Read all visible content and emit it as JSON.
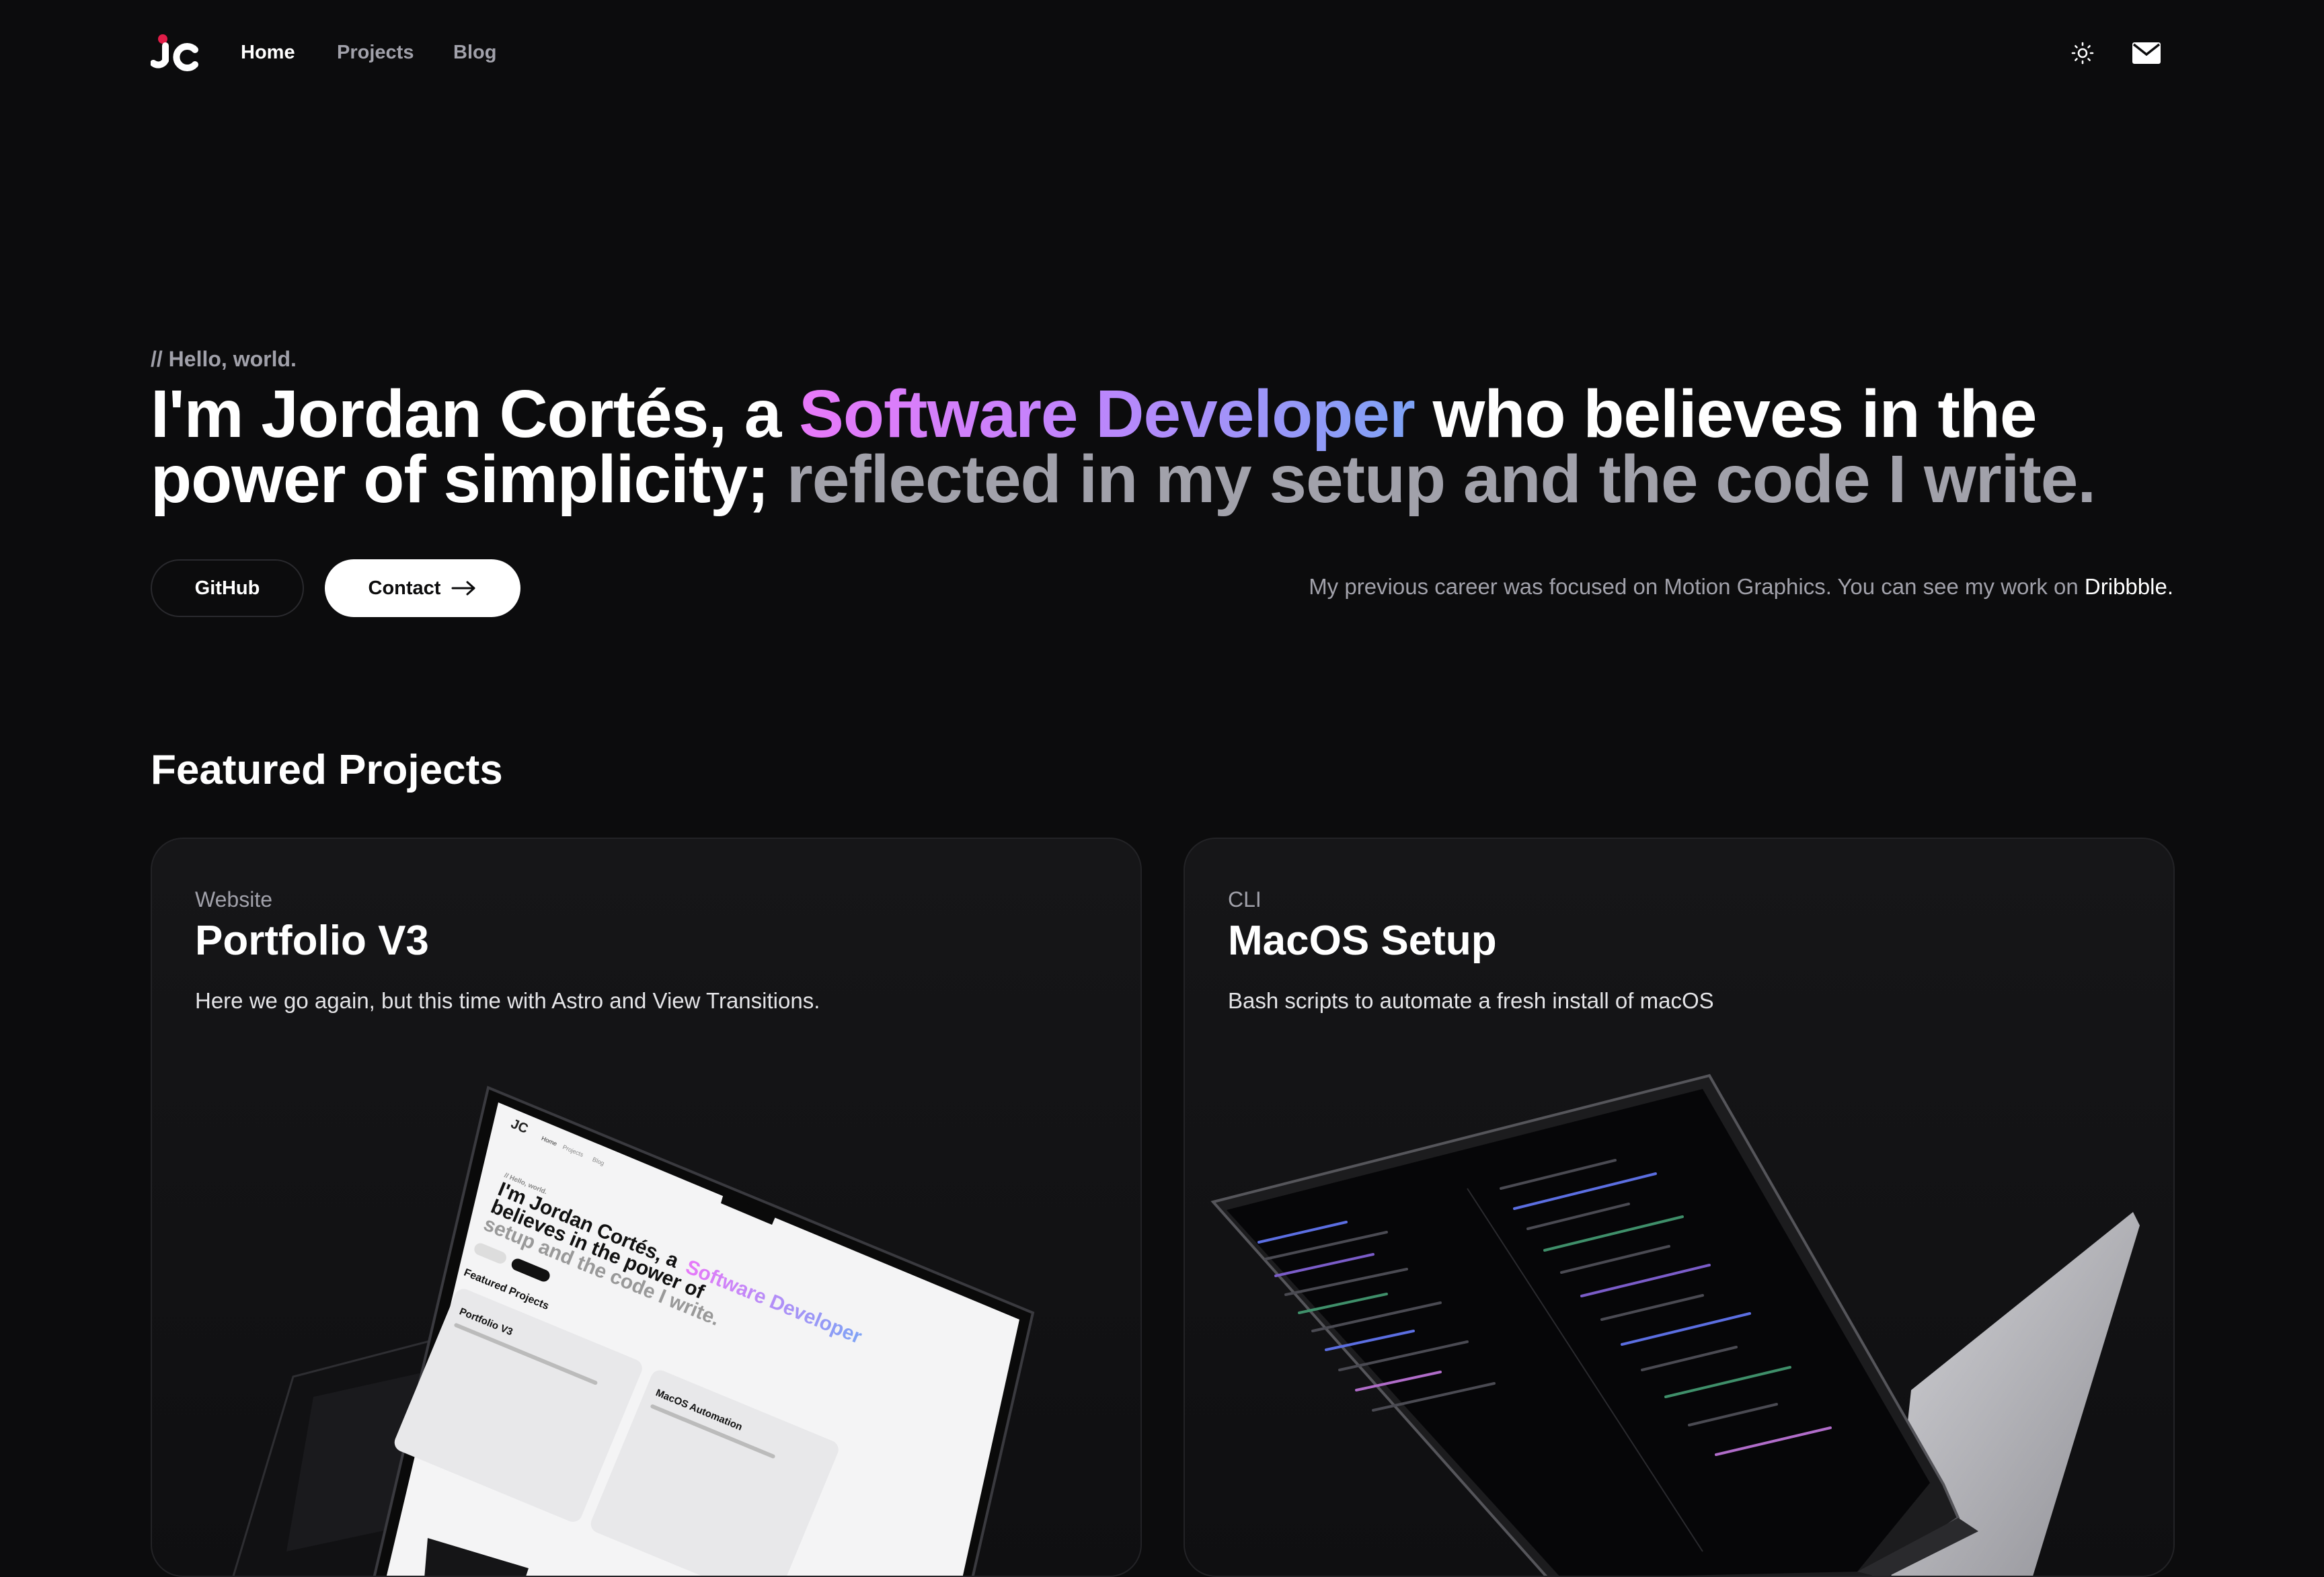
{
  "nav": {
    "links": [
      {
        "label": "Home",
        "active": true
      },
      {
        "label": "Projects",
        "active": false
      },
      {
        "label": "Blog",
        "active": false
      }
    ],
    "icons": [
      "sun-icon",
      "mail-icon"
    ]
  },
  "hero": {
    "eyebrow": "// Hello, world.",
    "headline_intro": "I'm Jordan Cortés, a ",
    "headline_role": "Software Developer",
    "headline_mid": " who believes in the power of simplicity; ",
    "headline_tail": "reflected in my setup and the code I write.",
    "github_label": "GitHub",
    "contact_label": "Contact",
    "career_text": "My previous career was focused on Motion Graphics. You can see my work on ",
    "career_link": "Dribbble."
  },
  "featured": {
    "title": "Featured Projects",
    "cards": [
      {
        "category": "Website",
        "title": "Portfolio V3",
        "description": "Here we go again, but this time with Astro and View Transitions."
      },
      {
        "category": "CLI",
        "title": "MacOS Setup",
        "description": "Bash scripts to automate a fresh install of macOS"
      }
    ]
  },
  "colors": {
    "background": "#0c0c0d",
    "gradient_start": "#e879f9",
    "gradient_end": "#7ea3f5",
    "muted_text": "#a1a1aa",
    "logo_accent": "#e11d48"
  },
  "mockup": {
    "eyebrow": "// Hello, world.",
    "headline": [
      "I'm Jordan Cortés, a",
      "believes in the power of",
      "setup and the code I write."
    ],
    "role": "Software Developer",
    "section": "Featured Projects",
    "card_1": "Portfolio V3",
    "card_2": "MacOS Automation"
  }
}
